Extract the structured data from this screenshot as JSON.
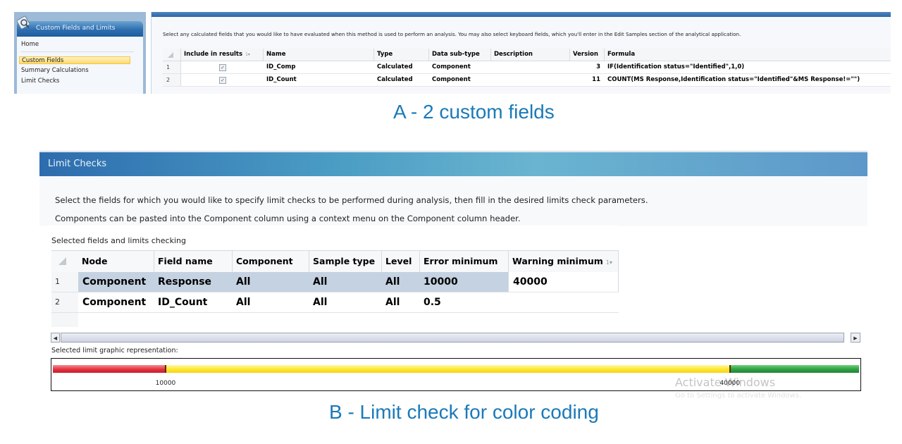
{
  "panel_a": {
    "nav": {
      "title": "Custom Fields and Limits",
      "items": [
        {
          "label": "Home"
        },
        {
          "label": "Custom Fields",
          "selected": true
        },
        {
          "label": "Summary Calculations"
        },
        {
          "label": "Limit Checks"
        }
      ]
    },
    "description": "Select any calculated fields that you would like to have evaluated when this method is used to perform an analysis. You may also select keyboard fields, which you'll enter in the Edit Samples section of the analytical application.",
    "grid": {
      "columns": [
        "Include in results",
        "Name",
        "Type",
        "Data sub-type",
        "Description",
        "Version",
        "Formula"
      ],
      "sort_indicator": "1",
      "rows": [
        {
          "num": "1",
          "include": "✓",
          "name": "ID_Comp",
          "type": "Calculated",
          "subtype": "Component",
          "description": "",
          "version": "3",
          "formula": "IF(Identification status=\"Identified\",1,0)"
        },
        {
          "num": "2",
          "include": "✓",
          "name": "ID_Count",
          "type": "Calculated",
          "subtype": "Component",
          "description": "",
          "version": "11",
          "formula": "COUNT(MS Response,Identification status=\"Identified\"&MS Response!=\"\")"
        }
      ]
    },
    "caption": "A - 2 custom fields"
  },
  "panel_b": {
    "title": "Limit Checks",
    "description_1": "Select the fields for which you would like to specify limit checks to be performed during analysis, then fill in the desired limits check parameters.",
    "description_2": "Components can be pasted into the Component column using a context menu on the Component column header.",
    "grid_label": "Selected fields and limits checking",
    "grid": {
      "columns": [
        "Node",
        "Field name",
        "Component",
        "Sample type",
        "Level",
        "Error minimum",
        "Warning minimum"
      ],
      "sort_indicator": "1",
      "rows": [
        {
          "num": "1",
          "node": "Component",
          "field_name": "Response",
          "component": "All",
          "sample_type": "All",
          "level": "All",
          "error_min": "10000",
          "warning_min": "40000"
        },
        {
          "num": "2",
          "node": "Component",
          "field_name": "ID_Count",
          "component": "All",
          "sample_type": "All",
          "level": "All",
          "error_min": "0.5",
          "warning_min": ""
        }
      ]
    },
    "graphic_label": "Selected limit graphic representation:",
    "limit_graphic": {
      "error_min_label": "10000",
      "warning_min_label": "40000",
      "error_fraction": 0.14,
      "warning_fraction": 0.84,
      "colors": {
        "error": "#e02c3a",
        "warning": "#ffe933",
        "ok": "#2ea042"
      }
    },
    "watermark": "Activate Windows",
    "watermark_sub": "Go to Settings to activate Windows.",
    "caption": "B - Limit check for color coding"
  },
  "colors": {
    "caption": "#1a7ab8",
    "header_blue": "#2d6cae",
    "selected_row": "#c5d2e1",
    "nav_selected": "#ffd86a"
  },
  "icons": {
    "check": "✓",
    "scroll_left": "◀",
    "scroll_right": "▶",
    "sort_down": "▾"
  }
}
